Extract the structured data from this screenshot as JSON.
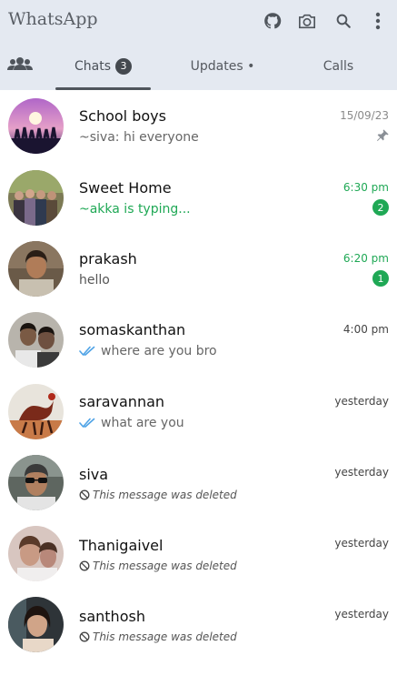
{
  "app": {
    "title": "WhatsApp",
    "accent": "#1fa855",
    "toolbar_icons": [
      "github-icon",
      "camera-icon",
      "search-icon",
      "more-vert-icon"
    ]
  },
  "tabs": {
    "community_icon": "community-icon",
    "chats_label": "Chats",
    "chats_count": "3",
    "updates_label": "Updates •",
    "calls_label": "Calls",
    "active": "Chats"
  },
  "chats": [
    {
      "name": "School boys",
      "preview": "~siva: hi everyone",
      "time": "15/09/23",
      "pinned": true
    },
    {
      "name": "Sweet Home",
      "preview": "~akka is typing...",
      "time": "6:30 pm",
      "unread": "2",
      "typing": true
    },
    {
      "name": "prakash",
      "preview": "hello",
      "time": "6:20 pm",
      "unread": "1"
    },
    {
      "name": "somaskanthan",
      "preview": "where are you bro",
      "time": "4:00 pm",
      "read_ticks": true
    },
    {
      "name": "saravannan",
      "preview": "what are you",
      "time": "yesterday",
      "read_ticks": true
    },
    {
      "name": "siva",
      "preview": "This message was deleted",
      "time": "yesterday",
      "deleted": true
    },
    {
      "name": "Thanigaivel",
      "preview": "This message was deleted",
      "time": "yesterday",
      "deleted": true
    },
    {
      "name": "santhosh",
      "preview": "This message was deleted",
      "time": "yesterday",
      "deleted": true
    }
  ]
}
